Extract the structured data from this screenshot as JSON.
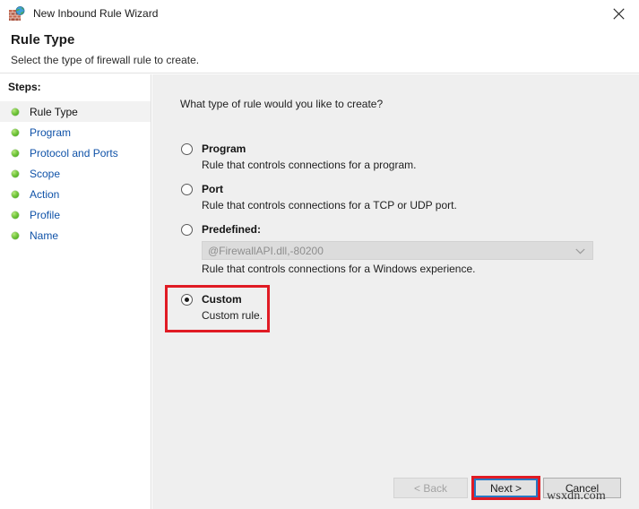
{
  "window": {
    "title": "New Inbound Rule Wizard",
    "icon": "firewall-globe-icon",
    "close_label": "×"
  },
  "header": {
    "title": "Rule Type",
    "subtitle": "Select the type of firewall rule to create."
  },
  "sidebar": {
    "label": "Steps:",
    "items": [
      {
        "label": "Rule Type",
        "active": true
      },
      {
        "label": "Program",
        "active": false
      },
      {
        "label": "Protocol and Ports",
        "active": false
      },
      {
        "label": "Scope",
        "active": false
      },
      {
        "label": "Action",
        "active": false
      },
      {
        "label": "Profile",
        "active": false
      },
      {
        "label": "Name",
        "active": false
      }
    ]
  },
  "main": {
    "question": "What type of rule would you like to create?",
    "options": [
      {
        "title": "Program",
        "description": "Rule that controls connections for a program.",
        "selected": false
      },
      {
        "title": "Port",
        "description": "Rule that controls connections for a TCP or UDP port.",
        "selected": false
      },
      {
        "title": "Predefined:",
        "description": "Rule that controls connections for a Windows experience.",
        "selected": false,
        "combo_value": "@FirewallAPI.dll,-80200"
      },
      {
        "title": "Custom",
        "description": "Custom rule.",
        "selected": true
      }
    ]
  },
  "footer": {
    "back_label": "< Back",
    "next_label": "Next >",
    "cancel_label": "Cancel"
  },
  "watermark": "wsxdn.com",
  "colors": {
    "annotation": "#e01b24",
    "link": "#0f52a8",
    "content_bg": "#efefef",
    "focus": "#2678c4"
  }
}
